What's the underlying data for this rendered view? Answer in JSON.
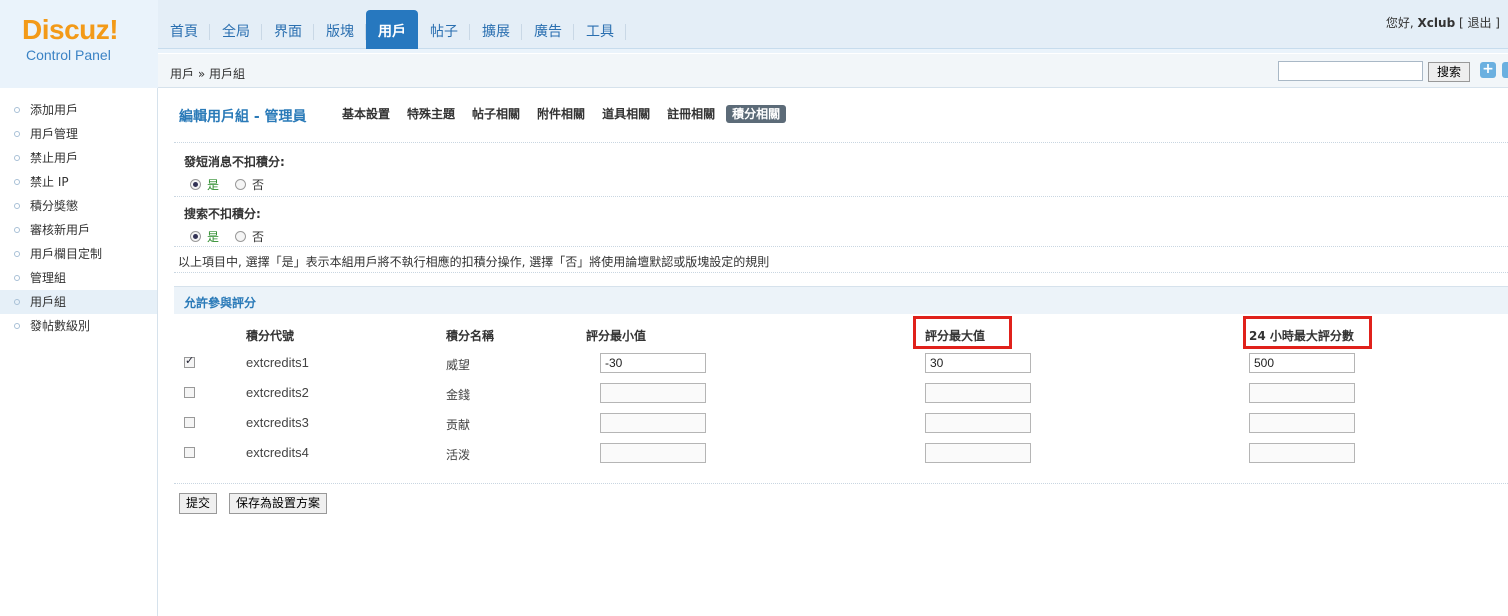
{
  "logo": {
    "brand": "Discuz!",
    "subtitle": "Control Panel"
  },
  "nav": {
    "tabs": [
      "首頁",
      "全局",
      "界面",
      "版塊",
      "用戶",
      "帖子",
      "擴展",
      "廣告",
      "工具"
    ]
  },
  "user": {
    "greeting": "您好,",
    "name": "Xclub",
    "logout": "[ 退出 ]"
  },
  "breadcrumb": "用戶 » 用戶組",
  "search": {
    "button": "搜索",
    "plus": "+"
  },
  "sidebar": {
    "items": [
      "添加用戶",
      "用戶管理",
      "禁止用戶",
      "禁止 IP",
      "積分獎懲",
      "審核新用戶",
      "用戶欄目定制",
      "管理組",
      "用戶組",
      "發帖數級別"
    ]
  },
  "edit": {
    "title": "編輯用戶組 - 管理員"
  },
  "subtabs": [
    "基本設置",
    "特殊主題",
    "帖子相關",
    "附件相關",
    "道具相關",
    "註冊相關",
    "積分相關"
  ],
  "options": [
    {
      "label": "發短消息不扣積分:",
      "yes": "是",
      "no": "否",
      "selected": "yes"
    },
    {
      "label": "搜索不扣積分:",
      "yes": "是",
      "no": "否",
      "selected": "yes"
    }
  ],
  "note": "以上項目中, 選擇「是」表示本組用戶將不執行相應的扣積分操作, 選擇「否」將使用論壇默認或版塊設定的規則",
  "section": {
    "title": "允許參與評分"
  },
  "table": {
    "headers": {
      "code": "積分代號",
      "name": "積分名稱",
      "min": "評分最小值",
      "max": "評分最大值",
      "daily": "24 小時最大評分數"
    },
    "rows": [
      {
        "checked": true,
        "code": "extcredits1",
        "name": "威望",
        "min": "-30",
        "max": "30",
        "daily": "500"
      },
      {
        "checked": false,
        "code": "extcredits2",
        "name": "金錢",
        "min": "",
        "max": "",
        "daily": ""
      },
      {
        "checked": false,
        "code": "extcredits3",
        "name": "贡献",
        "min": "",
        "max": "",
        "daily": ""
      },
      {
        "checked": false,
        "code": "extcredits4",
        "name": "活泼",
        "min": "",
        "max": "",
        "daily": ""
      }
    ]
  },
  "buttons": {
    "submit": "提交",
    "save_scheme": "保存為設置方案"
  },
  "colors": {
    "brand_orange": "#f39a18",
    "nav_active": "#2778bf",
    "highlight_red": "#e0211b",
    "link_blue": "#2a7ab8"
  }
}
